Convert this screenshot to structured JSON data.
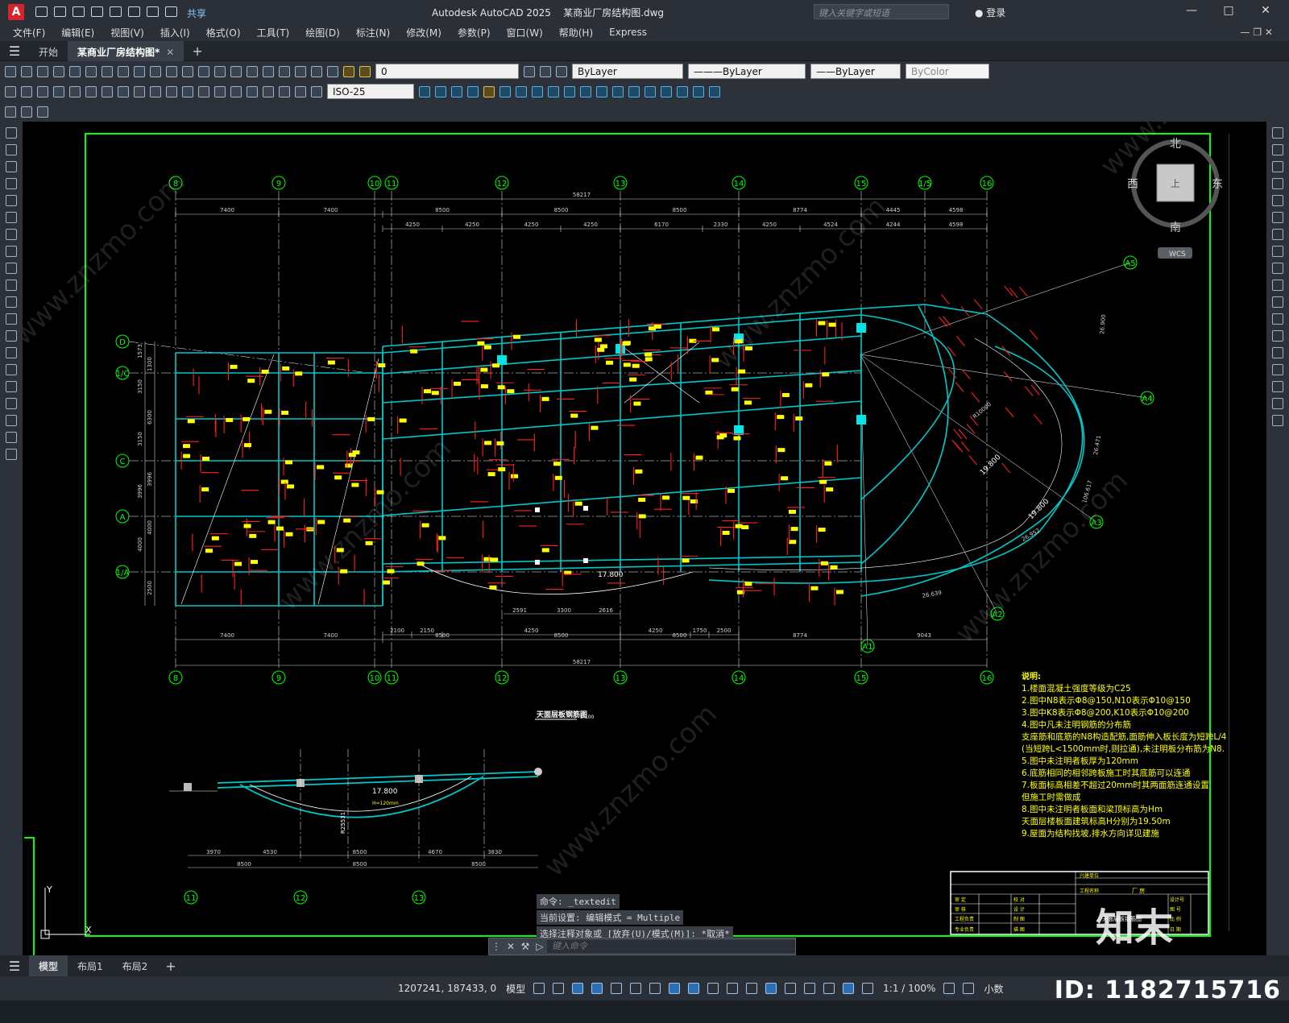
{
  "app": {
    "title": "Autodesk AutoCAD 2025",
    "filename": "某商业厂房结构图.dwg",
    "share": "共享",
    "search_placeholder": "键入关键字或短语",
    "login": "登录"
  },
  "menu": [
    "文件(F)",
    "编辑(E)",
    "视图(V)",
    "插入(I)",
    "格式(O)",
    "工具(T)",
    "绘图(D)",
    "标注(N)",
    "修改(M)",
    "参数(P)",
    "窗口(W)",
    "帮助(H)",
    "Express"
  ],
  "doc_tabs": {
    "start": "开始",
    "active": "某商业厂房结构图*"
  },
  "toolbar": {
    "layer": "0",
    "color": "ByLayer",
    "linetype": "ByLayer",
    "lineweight": "ByLayer",
    "plotstyle": "ByColor",
    "dimstyle": "ISO-25"
  },
  "viewcube": {
    "north": "北",
    "south": "南",
    "west": "西",
    "east": "东",
    "wcs": "WCS"
  },
  "drawing": {
    "grid_top": [
      "8",
      "9",
      "10",
      "11",
      "12",
      "13",
      "14",
      "15",
      "1/5",
      "16"
    ],
    "grid_bottom": [
      "8",
      "9",
      "10",
      "11",
      "12",
      "13",
      "14",
      "15",
      "16"
    ],
    "grid_left": [
      "D",
      "1/C",
      "C",
      "A",
      "1/A"
    ],
    "grid_right": [
      "A5",
      "A4",
      "A3",
      "A2",
      "A1"
    ],
    "dims_top_total": "58217",
    "dims_top_1": [
      "7400",
      "7400",
      "8500",
      "8500",
      "8500",
      "8774",
      "4445",
      "4598"
    ],
    "dims_top_2": [
      "4250",
      "4250",
      "4250",
      "4250",
      "6170",
      "2330",
      "4250",
      "4524",
      "4244",
      "4598"
    ],
    "dims_bottom_1": [
      "7400",
      "7400",
      "8500",
      "8500",
      "8500",
      "8774",
      "9043"
    ],
    "dims_bottom_2": [
      "2100",
      "2150",
      "4250",
      "4250",
      "1750",
      "2500"
    ],
    "dims_bottom_total": "58217",
    "dims_left": [
      "1573",
      "1300",
      "3150",
      "6300",
      "3150",
      "3996",
      "3996",
      "4000",
      "4000",
      "2500"
    ],
    "plan_title": "天面层板钢筋图",
    "plan_scale": "1:100",
    "elev_label": "17.800",
    "arc_dims": [
      "2591",
      "3300",
      "2616"
    ],
    "radius_labels": [
      "19.800",
      "19.800",
      "R10000",
      "26.639",
      "26.952",
      "26.471",
      "26.900",
      "106.617"
    ],
    "section": {
      "grid": [
        "11",
        "12",
        "13"
      ],
      "dims_1": [
        "3970",
        "4530",
        "8500",
        "4670",
        "3830"
      ],
      "dims_2": [
        "8500",
        "8500",
        "8500"
      ],
      "elev": "17.800",
      "h": "H=120mm",
      "radius": "R25531"
    },
    "notes_title": "说明:",
    "notes": [
      "1.楼面混凝土强度等级为C25",
      "2.图中N8表示Φ8@150,N10表示Φ10@150",
      "3.图中K8表示Φ8@200,K10表示Φ10@200",
      "4.图中凡未注明钢筋的分布筋",
      "  支座筋和底筋的N8构造配筋,面筋伸入板长度为短跨L/4",
      "  (当短跨L<1500mm时,则拉通),未注明板分布筋为N8.",
      "5.图中未注明者板厚为120mm",
      "6.底筋相同的相邻跨板施工时其底筋可以连通",
      "7.板面标高相差不超过20mm时其两面筋连通设置",
      "  但施工时需做成",
      "8.图中未注明者板面和梁顶标高为Hm",
      "  天面层楼板面建筑标高H分别为19.50m",
      "9.屋面为结构找坡,排水方向详见建施"
    ],
    "titleblock": {
      "r1": "兴建单位",
      "r2": "工程名称",
      "proj": "厂 房",
      "dwg": "天面层板钢筋图",
      "rows": [
        "审 定",
        "审 核",
        "工程负责",
        "专业负责"
      ],
      "rows2": [
        "校 对",
        "设 计",
        "制 图",
        "描 图"
      ],
      "rows3": [
        "设计号",
        "图 号",
        "比 例",
        "日 期"
      ]
    }
  },
  "command": {
    "lines": [
      "命令: _textedit",
      "当前设置: 编辑模式 = Multiple",
      "选择注释对象或 [放弃(U)/模式(M)]: *取消*"
    ],
    "placeholder": "键入命令"
  },
  "layout_tabs": [
    "模型",
    "布局1",
    "布局2"
  ],
  "status": {
    "coords": "1207241, 187433, 0",
    "model": "模型",
    "scale": "1:1 / 100%",
    "units": "小数"
  },
  "watermark": {
    "id": "ID: 1182715716",
    "site": "www.znzmo.com",
    "brand": "知末"
  },
  "colors": {
    "bg": "#000000",
    "frame": "#00ff00",
    "beam": "#00c8c8",
    "rebar": "#ff2020",
    "grid": "#ffffff",
    "label": "#ffff00",
    "dim": "#d0d0d0"
  }
}
